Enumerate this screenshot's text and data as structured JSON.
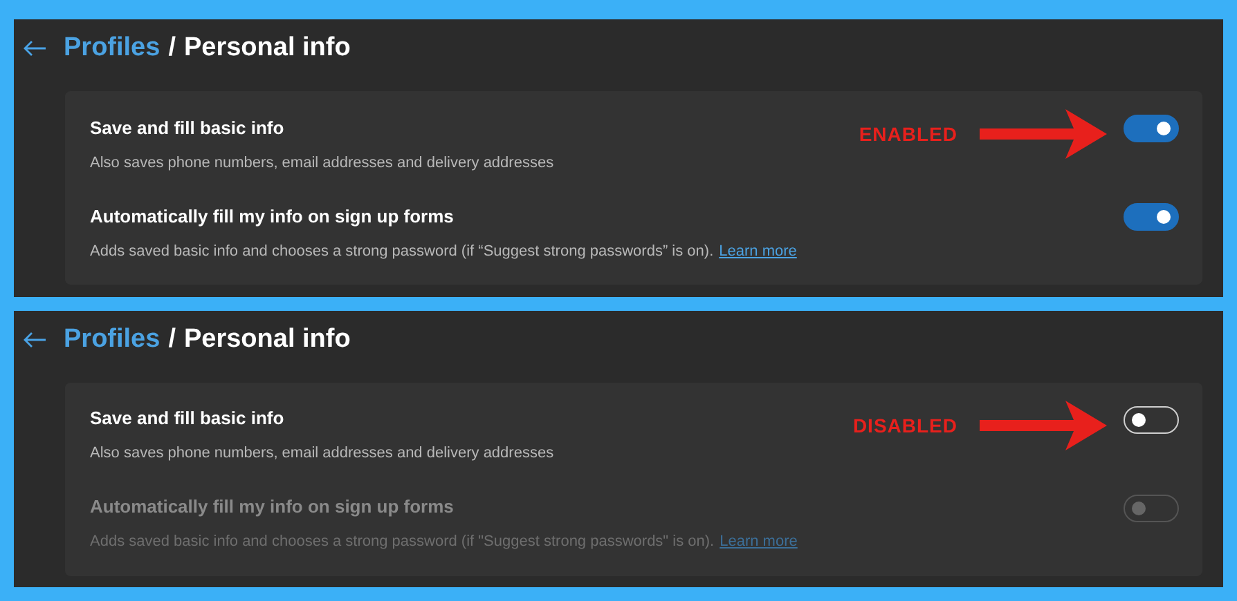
{
  "panels": [
    {
      "breadcrumb": {
        "parent": "Profiles",
        "separator": "/",
        "current": "Personal info"
      },
      "settings": [
        {
          "title": "Save and fill basic info",
          "description": "Also saves phone numbers, email addresses and delivery addresses",
          "on": true,
          "disabled": false,
          "annotation": "ENABLED"
        },
        {
          "title": "Automatically fill my info on sign up forms",
          "description": "Adds saved basic info and chooses a strong password (if “Suggest strong passwords” is on).",
          "link": "Learn more",
          "on": true,
          "disabled": false
        }
      ]
    },
    {
      "breadcrumb": {
        "parent": "Profiles",
        "separator": "/",
        "current": "Personal info"
      },
      "settings": [
        {
          "title": "Save and fill basic info",
          "description": "Also saves phone numbers, email addresses and delivery addresses",
          "on": false,
          "disabled": false,
          "annotation": "DISABLED"
        },
        {
          "title": "Automatically fill my info on sign up forms",
          "description": "Adds saved basic info and chooses a strong password (if \"Suggest strong passwords\" is on).",
          "link": "Learn more",
          "on": false,
          "disabled": true
        }
      ]
    }
  ]
}
